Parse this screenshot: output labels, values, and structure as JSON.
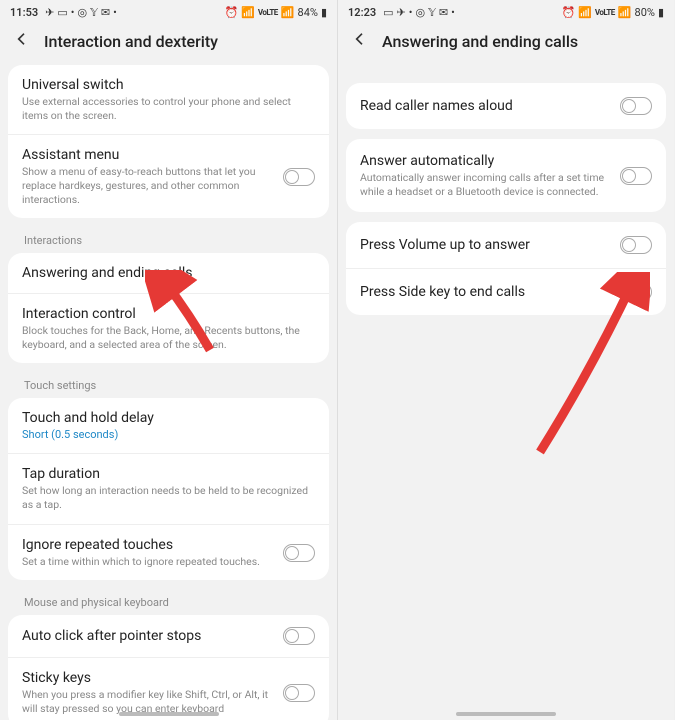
{
  "left": {
    "status": {
      "time": "11:53",
      "battery": "84%"
    },
    "title": "Interaction and dexterity",
    "card1": [
      {
        "title": "Universal switch",
        "desc": "Use external accessories to control your phone and select items on the screen."
      },
      {
        "title": "Assistant menu",
        "desc": "Show a menu of easy-to-reach buttons that let you replace hardkeys, gestures, and other common interactions.",
        "toggle": true
      }
    ],
    "section1": "Interactions",
    "card2": [
      {
        "title": "Answering and ending calls"
      },
      {
        "title": "Interaction control",
        "desc": "Block touches for the Back, Home, and Recents buttons, the keyboard, and a selected area of the screen."
      }
    ],
    "section2": "Touch settings",
    "card3": [
      {
        "title": "Touch and hold delay",
        "value": "Short (0.5 seconds)"
      },
      {
        "title": "Tap duration",
        "desc": "Set how long an interaction needs to be held to be recognized as a tap."
      },
      {
        "title": "Ignore repeated touches",
        "desc": "Set a time within which to ignore repeated touches.",
        "toggle": true
      }
    ],
    "section3": "Mouse and physical keyboard",
    "card4": [
      {
        "title": "Auto click after pointer stops",
        "toggle": true
      },
      {
        "title": "Sticky keys",
        "desc": "When you press a modifier key like Shift, Ctrl, or Alt, it will stay pressed so you can enter keyboard",
        "toggle": true
      }
    ]
  },
  "right": {
    "status": {
      "time": "12:23",
      "battery": "80%"
    },
    "title": "Answering and ending calls",
    "card1": [
      {
        "title": "Read caller names aloud",
        "toggle": true
      }
    ],
    "card2": [
      {
        "title": "Answer automatically",
        "desc": "Automatically answer incoming calls after a set time while a headset or a Bluetooth device is connected.",
        "toggle": true
      }
    ],
    "card3": [
      {
        "title": "Press Volume up to answer",
        "toggle": true
      },
      {
        "title": "Press Side key to end calls",
        "toggle": true
      }
    ]
  }
}
